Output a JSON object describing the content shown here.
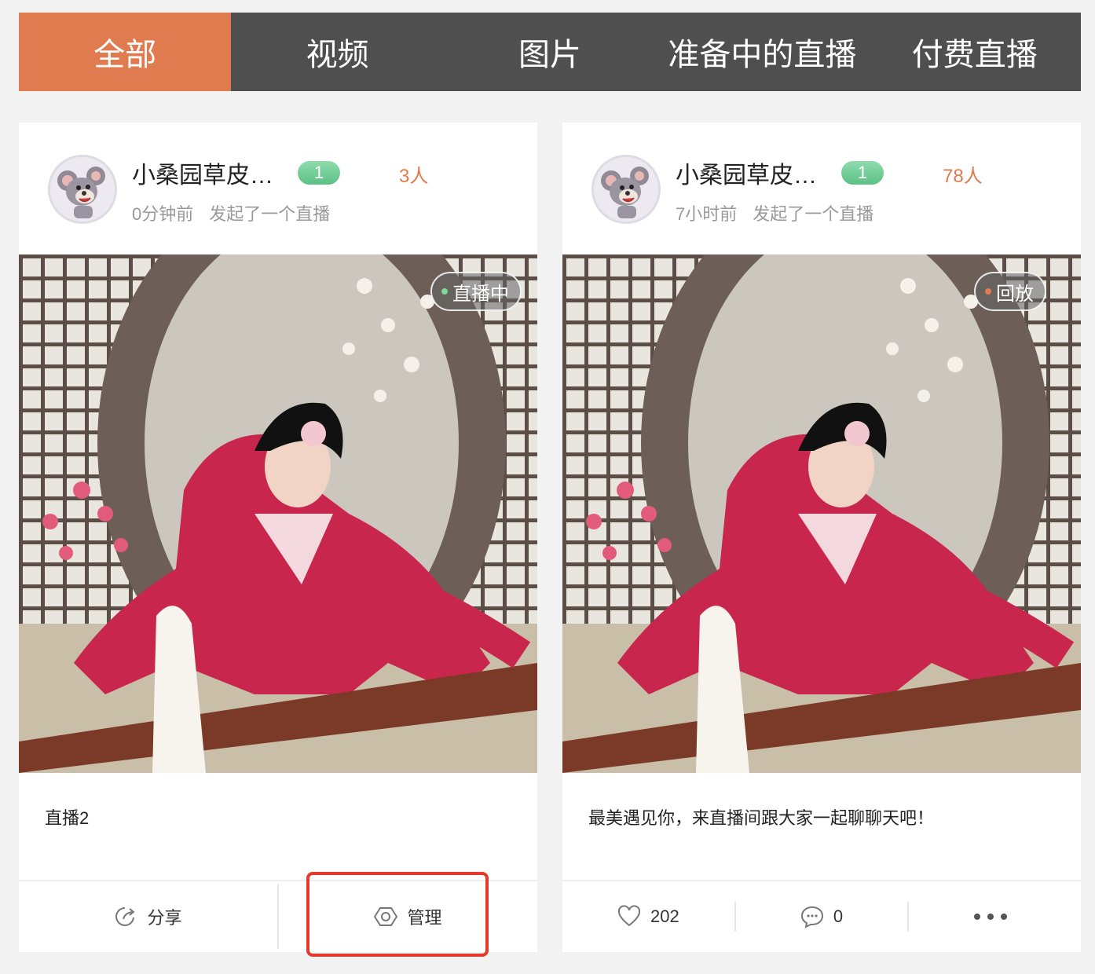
{
  "tabs": [
    "全部",
    "视频",
    "图片",
    "准备中的直播",
    "付费直播"
  ],
  "cards": [
    {
      "username": "小桑园草皮…",
      "level": "1",
      "viewers": "3人",
      "time": "0分钟前",
      "action": "发起了一个直播",
      "status": "直播中",
      "status_dot_color": "#7ed99a",
      "caption": "直播2",
      "footer": {
        "share": "分享",
        "manage": "管理"
      }
    },
    {
      "username": "小桑园草皮…",
      "level": "1",
      "viewers": "78人",
      "time": "7小时前",
      "action": "发起了一个直播",
      "status": "回放",
      "status_dot_color": "#e07b50",
      "caption": "最美遇见你，来直播间跟大家一起聊聊天吧！",
      "footer": {
        "likes": "202",
        "comments": "0"
      }
    }
  ],
  "colors": {
    "accent": "#e07b50",
    "tabbar": "#4f4f4f",
    "highlight": "#e53a2b",
    "level_badge": "#6fcf97"
  },
  "icons": [
    "share-icon",
    "manage-hexagon-icon",
    "heart-icon",
    "comment-icon",
    "more-icon"
  ]
}
